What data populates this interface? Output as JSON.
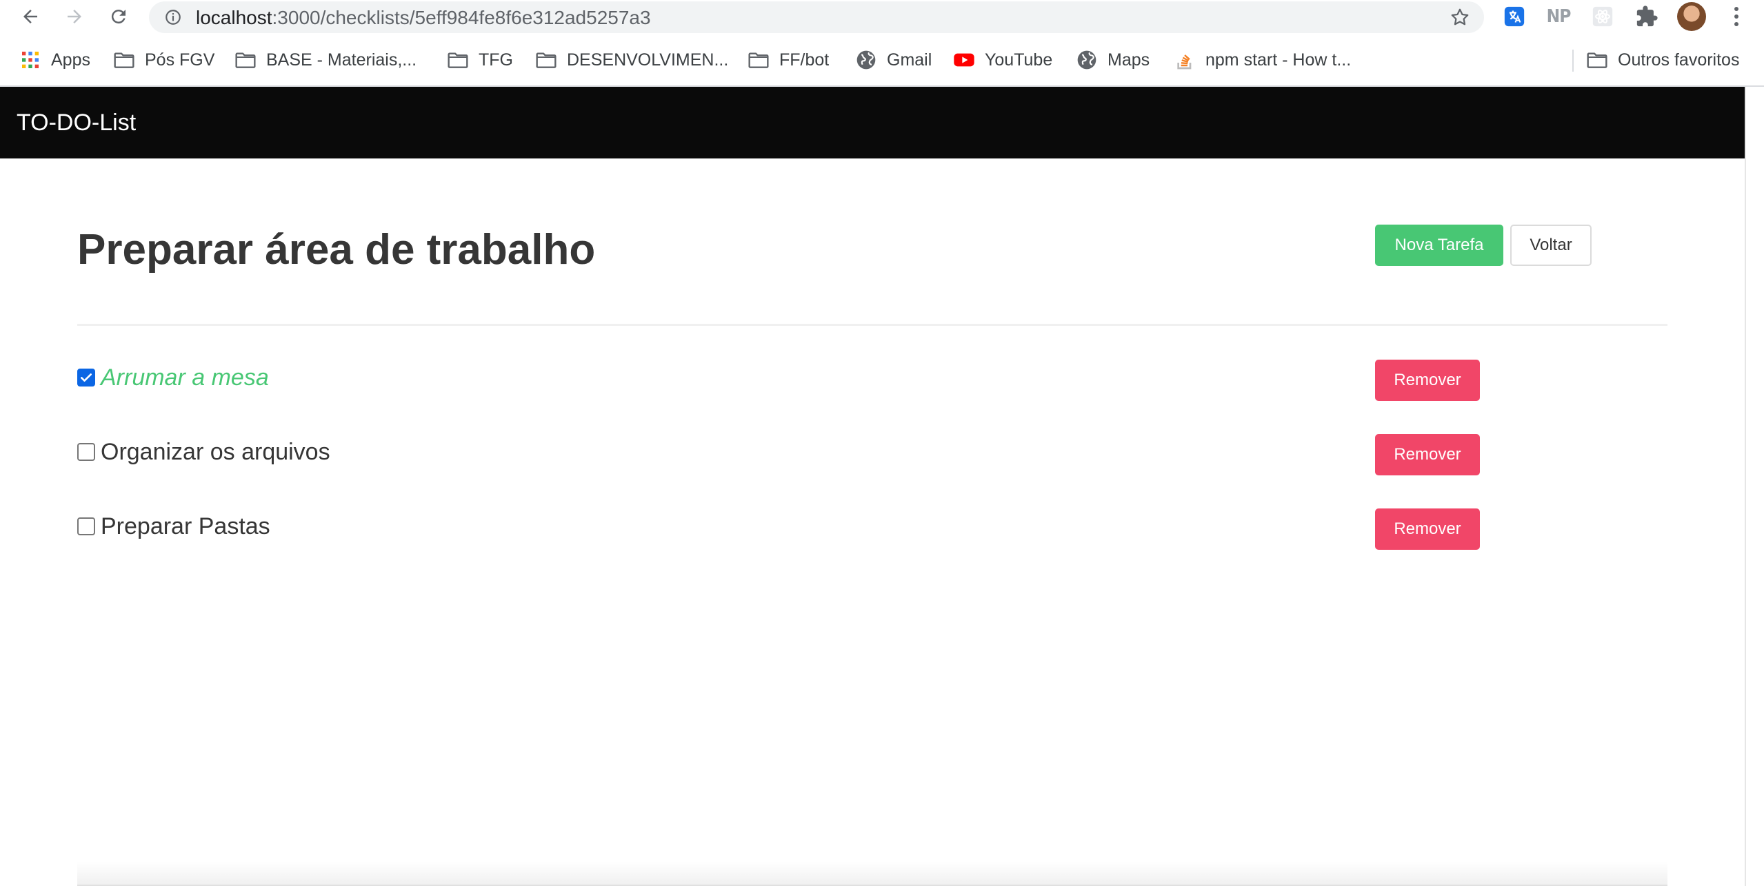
{
  "browser": {
    "url_host": "localhost",
    "url_path": ":3000/checklists/5eff984fe8f6e312ad5257a3",
    "extensions": {
      "ext1_icon": "translate-extension-icon",
      "np_label": "NP",
      "ext3_icon": "react-devtools-icon",
      "puzzle_icon": "extensions-puzzle-icon"
    },
    "bookmarks": [
      {
        "label": "Apps",
        "icon": "apps-grid-icon"
      },
      {
        "label": "Pós FGV",
        "icon": "folder-icon"
      },
      {
        "label": "BASE - Materiais,...",
        "icon": "folder-icon"
      },
      {
        "label": "TFG",
        "icon": "folder-icon"
      },
      {
        "label": "DESENVOLVIMEN...",
        "icon": "folder-icon"
      },
      {
        "label": "FF/bot",
        "icon": "folder-icon"
      },
      {
        "label": "Gmail",
        "icon": "globe-icon"
      },
      {
        "label": "YouTube",
        "icon": "youtube-icon"
      },
      {
        "label": "Maps",
        "icon": "globe-icon"
      },
      {
        "label": "npm start - How t...",
        "icon": "stackoverflow-icon"
      }
    ],
    "other_bookmarks": "Outros favoritos"
  },
  "app": {
    "brand": "TO-DO-List",
    "checklist_title": "Preparar área de trabalho",
    "new_task_button": "Nova Tarefa",
    "back_button": "Voltar",
    "tasks": [
      {
        "name": "Arrumar a mesa",
        "done": true,
        "remove_label": "Remover"
      },
      {
        "name": "Organizar os arquivos",
        "done": false,
        "remove_label": "Remover"
      },
      {
        "name": "Preparar Pastas",
        "done": false,
        "remove_label": "Remover"
      }
    ]
  },
  "colors": {
    "navbar": "#0a0a0a",
    "success": "#48c774",
    "danger": "#f14668",
    "checkbox_checked": "#0b66e4",
    "text": "#363636"
  }
}
